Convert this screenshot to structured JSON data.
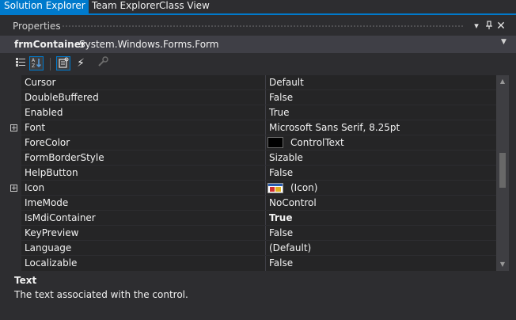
{
  "tabs": [
    {
      "label": "Solution Explorer",
      "active": true
    },
    {
      "label": "Team Explorer",
      "active": false
    },
    {
      "label": "Class View",
      "active": false
    }
  ],
  "panel": {
    "title": "Properties",
    "menu_icon": "dropdown-arrow-icon",
    "pin_icon": "pin-icon",
    "close_icon": "close-icon"
  },
  "object_selector": {
    "name": "frmContainer",
    "type": "System.Windows.Forms.Form"
  },
  "toolbar": {
    "icons": [
      "categorized-icon",
      "alphabetical-icon",
      "properties-icon",
      "events-icon",
      "property-pages-icon"
    ],
    "selected": [
      "alphabetical-icon",
      "properties-icon"
    ]
  },
  "properties": [
    {
      "name": "Cursor",
      "value": "Default"
    },
    {
      "name": "DoubleBuffered",
      "value": "False"
    },
    {
      "name": "Enabled",
      "value": "True"
    },
    {
      "name": "Font",
      "value": "Microsoft Sans Serif, 8.25pt",
      "expandable": true
    },
    {
      "name": "ForeColor",
      "value": "ControlText",
      "swatch": "#000000"
    },
    {
      "name": "FormBorderStyle",
      "value": "Sizable"
    },
    {
      "name": "HelpButton",
      "value": "False"
    },
    {
      "name": "Icon",
      "value": "(Icon)",
      "expandable": true,
      "thumbnail": "form-icon"
    },
    {
      "name": "ImeMode",
      "value": "NoControl"
    },
    {
      "name": "IsMdiContainer",
      "value": "True",
      "bold": true
    },
    {
      "name": "KeyPreview",
      "value": "False"
    },
    {
      "name": "Language",
      "value": "(Default)"
    },
    {
      "name": "Localizable",
      "value": "False"
    }
  ],
  "description": {
    "title": "Text",
    "text": "The text associated with the control."
  },
  "colors": {
    "accent": "#007acc",
    "background": "#2d2d30",
    "grid": "#252526",
    "text": "#f1f1f1"
  }
}
